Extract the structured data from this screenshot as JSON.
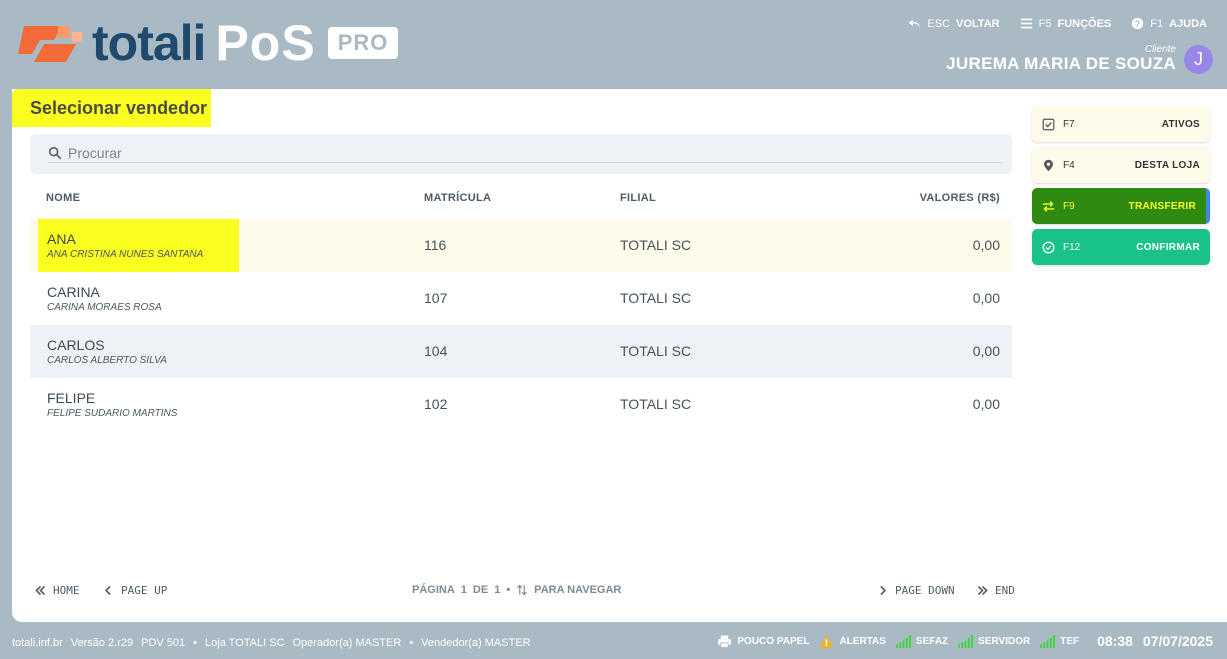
{
  "brand": {
    "name": "totali",
    "product": "PoS",
    "edition": "PRO"
  },
  "topnav": [
    {
      "key": "ESC",
      "label": "VOLTAR",
      "icon": "back-arrow-icon"
    },
    {
      "key": "F5",
      "label": "FUNÇÕES",
      "icon": "menu-icon"
    },
    {
      "key": "F1",
      "label": "AJUDA",
      "icon": "help-icon"
    }
  ],
  "client": {
    "label": "Cliente",
    "name": "JUREMA MARIA DE SOUZA",
    "initial": "J"
  },
  "page": {
    "title": "Selecionar vendedor"
  },
  "search": {
    "placeholder": "Procurar",
    "value": ""
  },
  "table": {
    "headers": {
      "name": "NOME",
      "matricula": "MATRÍCULA",
      "filial": "FILIAL",
      "valores": "VALORES (R$)"
    },
    "rows": [
      {
        "nick": "ANA",
        "full": "ANA CRISTINA NUNES SANTANA",
        "matricula": "116",
        "filial": "TOTALI SC",
        "valor": "0,00"
      },
      {
        "nick": "CARINA",
        "full": "CARINA MORAES ROSA",
        "matricula": "107",
        "filial": "TOTALI SC",
        "valor": "0,00"
      },
      {
        "nick": "CARLOS",
        "full": "CARLOS ALBERTO SILVA",
        "matricula": "104",
        "filial": "TOTALI SC",
        "valor": "0,00"
      },
      {
        "nick": "FELIPE",
        "full": "FELIPE SUDARIO MARTINS",
        "matricula": "102",
        "filial": "TOTALI SC",
        "valor": "0,00"
      }
    ]
  },
  "pager": {
    "home": "HOME",
    "page_up": "PAGE UP",
    "page_down": "PAGE DOWN",
    "end": "END",
    "page_label": "PÁGINA",
    "current": "1",
    "of_label": "DE",
    "total": "1",
    "bullet": "•",
    "nav_hint": "PARA NAVEGAR"
  },
  "sidebar": {
    "ativos": {
      "key": "F7",
      "label": "ATIVOS"
    },
    "loja": {
      "key": "F4",
      "label": "DESTA LOJA"
    },
    "transferir": {
      "key": "F9",
      "label": "TRANSFERIR"
    },
    "confirmar": {
      "key": "F12",
      "label": "CONFIRMAR"
    }
  },
  "footer": {
    "site": "totali.inf.br",
    "version": "Versão 2.r29",
    "pdv": "PDV 501",
    "bullet": "•",
    "loja": "Loja TOTALI SC",
    "operador": "Operador(a) MASTER",
    "vendedor": "Vendedor(a) MASTER",
    "status": {
      "papel": "POUCO PAPEL",
      "alertas": "ALERTAS",
      "sefaz": "SEFAZ",
      "servidor": "SERVIDOR",
      "tef": "TEF"
    },
    "time": "08:38",
    "date": "07/07/2025"
  },
  "colors": {
    "header_bg": "#a9bac4",
    "highlight": "#fbff1f",
    "transfer": "#2f8a12",
    "confirm": "#19c28a",
    "logo_orange": "#f26b38",
    "logo_blue": "#1f4a6e"
  }
}
